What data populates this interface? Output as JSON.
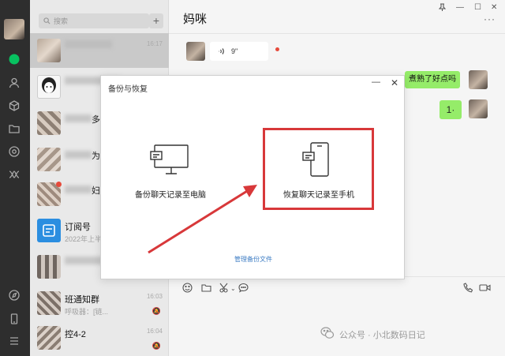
{
  "list": {
    "search_placeholder": "搜索",
    "add_icon": "+",
    "rows": [
      {
        "name": "",
        "sub": "",
        "time": "16:17"
      },
      {
        "name": "",
        "sub": "",
        "time": ""
      },
      {
        "name": "多",
        "sub": "",
        "time": ""
      },
      {
        "name": "为",
        "sub": "",
        "time": ""
      },
      {
        "name": "妇",
        "sub": "",
        "time": ""
      },
      {
        "name": "订阅号",
        "sub": "2022年上半",
        "time": ""
      },
      {
        "name": "",
        "sub": "",
        "time": ""
      },
      {
        "name": "班通知群",
        "sub": "呼吸器：[链...",
        "time": "16:03"
      },
      {
        "name": "控4-2",
        "sub": "",
        "time": "16:04"
      }
    ]
  },
  "chat": {
    "title": "妈咪",
    "voice_duration": "9\"",
    "voice_icon": "voice-wave-icon",
    "green_message": "煮熟了好点吗",
    "sticker": "1·"
  },
  "dialog": {
    "title": "备份与恢复",
    "option_pc": "备份聊天记录至电脑",
    "option_phone": "恢复聊天记录至手机",
    "manage_link": "管理备份文件",
    "min_symbol": "—",
    "close_symbol": "✕"
  },
  "watermark": {
    "text": "公众号 · 小北数码日记"
  },
  "colors": {
    "highlight": "#d8383a",
    "green_bubble": "#95ec69",
    "rail": "#2e2e2e",
    "link": "#3e7dc4"
  }
}
